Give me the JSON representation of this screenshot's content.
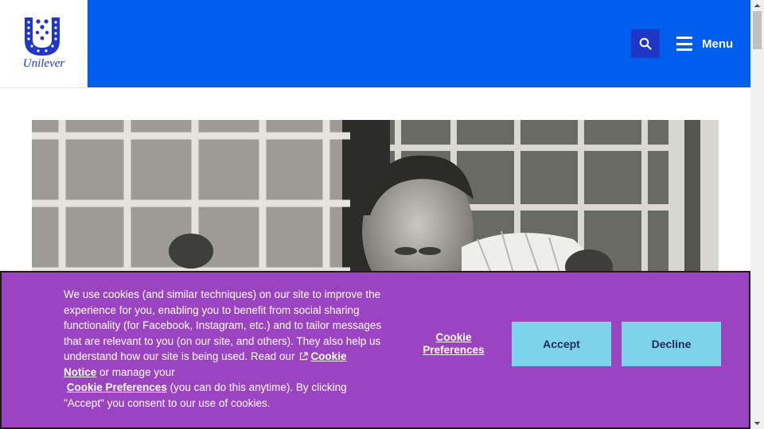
{
  "header": {
    "logo_text": "Unilever",
    "menu_label": "Menu",
    "brand_color": "#005eef",
    "logo_color": "#1f36c7"
  },
  "icons": {
    "search": "search-icon",
    "menu": "hamburger-icon",
    "external": "external-link-icon"
  },
  "cookie_banner": {
    "background_color": "#9b44c1",
    "text_intro": "We use cookies (and similar techniques) on our site to improve the experience for you, enabling you to benefit from social sharing functionality (for Facebook, Instagram, etc.) and to tailor messages that are relevant to you (on our site, and others). They also help us understand how our site is being used. Read our",
    "cookie_notice_link": "Cookie Notice",
    "text_middle": "or manage your",
    "cookie_preferences_inline": "Cookie Preferences",
    "text_end": "(you can do this anytime). By clicking \"Accept\" you consent to our use of cookies.",
    "preferences_button": "Cookie Preferences",
    "accept_button": "Accept",
    "decline_button": "Decline",
    "button_color": "#7dd4ea"
  }
}
